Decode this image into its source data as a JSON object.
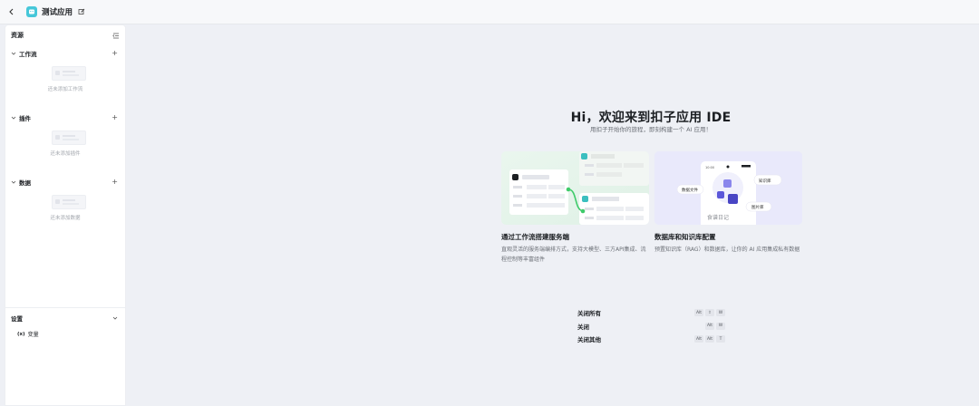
{
  "header": {
    "title": "测试应用",
    "back_icon": "chevron-left-icon",
    "logo_icon": "app-logo-icon",
    "edit_icon": "edit-icon"
  },
  "sidebar": {
    "title": "资源",
    "sections": [
      {
        "label": "工作流",
        "empty_text": "还未添加工作流"
      },
      {
        "label": "插件",
        "empty_text": "还未添加插件"
      },
      {
        "label": "数据",
        "empty_text": "还未添加数据"
      }
    ],
    "settings": {
      "label": "设置",
      "variable_icon": "(x)",
      "variable_label": "变量"
    }
  },
  "main": {
    "title": "Hi，欢迎来到扣子应用 IDE",
    "subtitle": "用扣子开始你的旅程，即刻构建一个 AI 应用！",
    "cards": [
      {
        "title": "通过工作流搭建服务端",
        "desc": "直观灵活的服务端编排方式，支持大模型、三方API集成、流程控制等丰富组件"
      },
      {
        "title": "数据库和知识库配置",
        "desc": "预置知识库（RAG）和数据库，让你的 AI 应用集成私有数据",
        "illus_labels": {
          "tag_left": "数据文件",
          "tag_right": "知识库",
          "tag_bottom": "图片库",
          "caption": "食谱日记",
          "time": "10:00"
        }
      }
    ],
    "shortcuts": [
      {
        "label": "关闭所有",
        "keys": [
          "Alt",
          "⇧",
          "W"
        ]
      },
      {
        "label": "关闭",
        "keys": [
          "Alt",
          "W"
        ]
      },
      {
        "label": "关闭其他",
        "keys": [
          "Alt",
          "Alt",
          "T"
        ]
      }
    ]
  },
  "colors": {
    "background": "#eef0f5",
    "brand_teal": "#46c7d9",
    "accent_green": "#3fcb6a",
    "accent_purple": "#5b57d9"
  }
}
